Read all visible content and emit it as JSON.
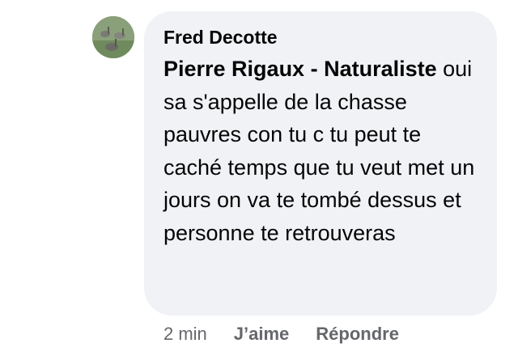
{
  "comment": {
    "author": "Fred Decotte",
    "mention": "Pierre Rigaux - Naturaliste",
    "text": " oui sa s'appelle de la chasse pauvres con tu c tu peut te caché temps que tu veut met un jours on va te tombé dessus et personne te retrouveras",
    "timestamp": "2 min",
    "like_label": "J’aime",
    "reply_label": "Répondre"
  },
  "colors": {
    "bubble_bg": "#f0f2f5",
    "text": "#050505",
    "meta": "#65676b"
  },
  "icons": {
    "avatar": "avatar-geese-photo"
  }
}
